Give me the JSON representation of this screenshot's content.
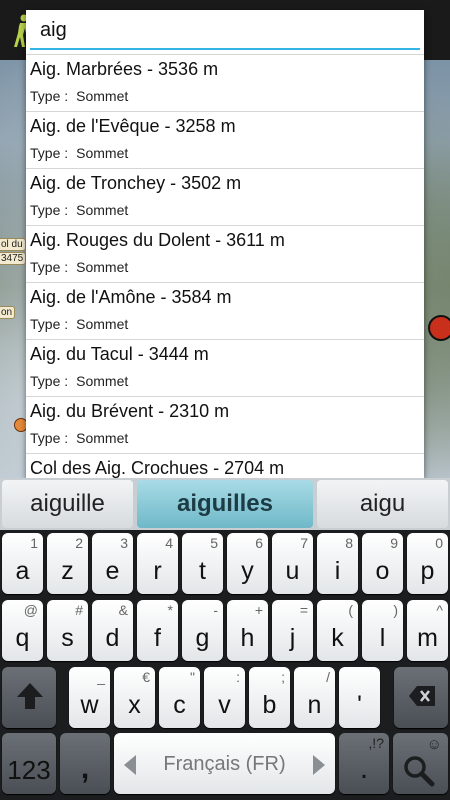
{
  "search": {
    "value": "aig"
  },
  "results": [
    {
      "title": "Aig. Marbrées - 3536 m",
      "type_label": "Type :",
      "type_value": "Sommet"
    },
    {
      "title": "Aig. de l'Evêque - 3258 m",
      "type_label": "Type :",
      "type_value": "Sommet"
    },
    {
      "title": "Aig. de Tronchey - 3502 m",
      "type_label": "Type :",
      "type_value": "Sommet"
    },
    {
      "title": "Aig. Rouges du Dolent - 3611 m",
      "type_label": "Type :",
      "type_value": "Sommet"
    },
    {
      "title": "Aig. de l'Amône - 3584 m",
      "type_label": "Type :",
      "type_value": "Sommet"
    },
    {
      "title": "Aig. du Tacul -  3444 m",
      "type_label": "Type :",
      "type_value": "Sommet"
    },
    {
      "title": "Aig. du Brévent - 2310 m",
      "type_label": "Type :",
      "type_value": "Sommet"
    },
    {
      "title": "Col des Aig. Crochues - 2704 m",
      "type_label": "",
      "type_value": ""
    }
  ],
  "map_labels": {
    "label_1": "ol du",
    "label_2": "3475",
    "label_3": "on"
  },
  "keyboard": {
    "suggestions": [
      "aiguille",
      "aiguilles",
      "aigu"
    ],
    "row1": [
      {
        "main": "a",
        "hint": "1"
      },
      {
        "main": "z",
        "hint": "2"
      },
      {
        "main": "e",
        "hint": "3"
      },
      {
        "main": "r",
        "hint": "4"
      },
      {
        "main": "t",
        "hint": "5"
      },
      {
        "main": "y",
        "hint": "6"
      },
      {
        "main": "u",
        "hint": "7"
      },
      {
        "main": "i",
        "hint": "8"
      },
      {
        "main": "o",
        "hint": "9"
      },
      {
        "main": "p",
        "hint": "0"
      }
    ],
    "row2": [
      {
        "main": "q",
        "hint": "@"
      },
      {
        "main": "s",
        "hint": "#"
      },
      {
        "main": "d",
        "hint": "&"
      },
      {
        "main": "f",
        "hint": "*"
      },
      {
        "main": "g",
        "hint": "-"
      },
      {
        "main": "h",
        "hint": "+"
      },
      {
        "main": "j",
        "hint": "="
      },
      {
        "main": "k",
        "hint": "("
      },
      {
        "main": "l",
        "hint": ")"
      },
      {
        "main": "m",
        "hint": "^"
      }
    ],
    "row3": [
      {
        "main": "w",
        "hint": "_"
      },
      {
        "main": "x",
        "hint": "€"
      },
      {
        "main": "c",
        "hint": "\""
      },
      {
        "main": "v",
        "hint": ":"
      },
      {
        "main": "b",
        "hint": ";"
      },
      {
        "main": "n",
        "hint": "/"
      },
      {
        "main": "'",
        "hint": ""
      }
    ],
    "symbols_key": "123",
    "comma_key": ",",
    "space_label": "Français (FR)",
    "period_key": ".",
    "period_hint": ",!?",
    "icons": {
      "shift": "shift-arrow-icon",
      "backspace": "backspace-icon",
      "search": "search-icon",
      "emoji": "smiley-icon",
      "app": "hiker-icon"
    }
  },
  "colors": {
    "accent": "#33b5e5",
    "suggestion_active": "#6fb8c8",
    "map_badge": "#c9301c"
  }
}
